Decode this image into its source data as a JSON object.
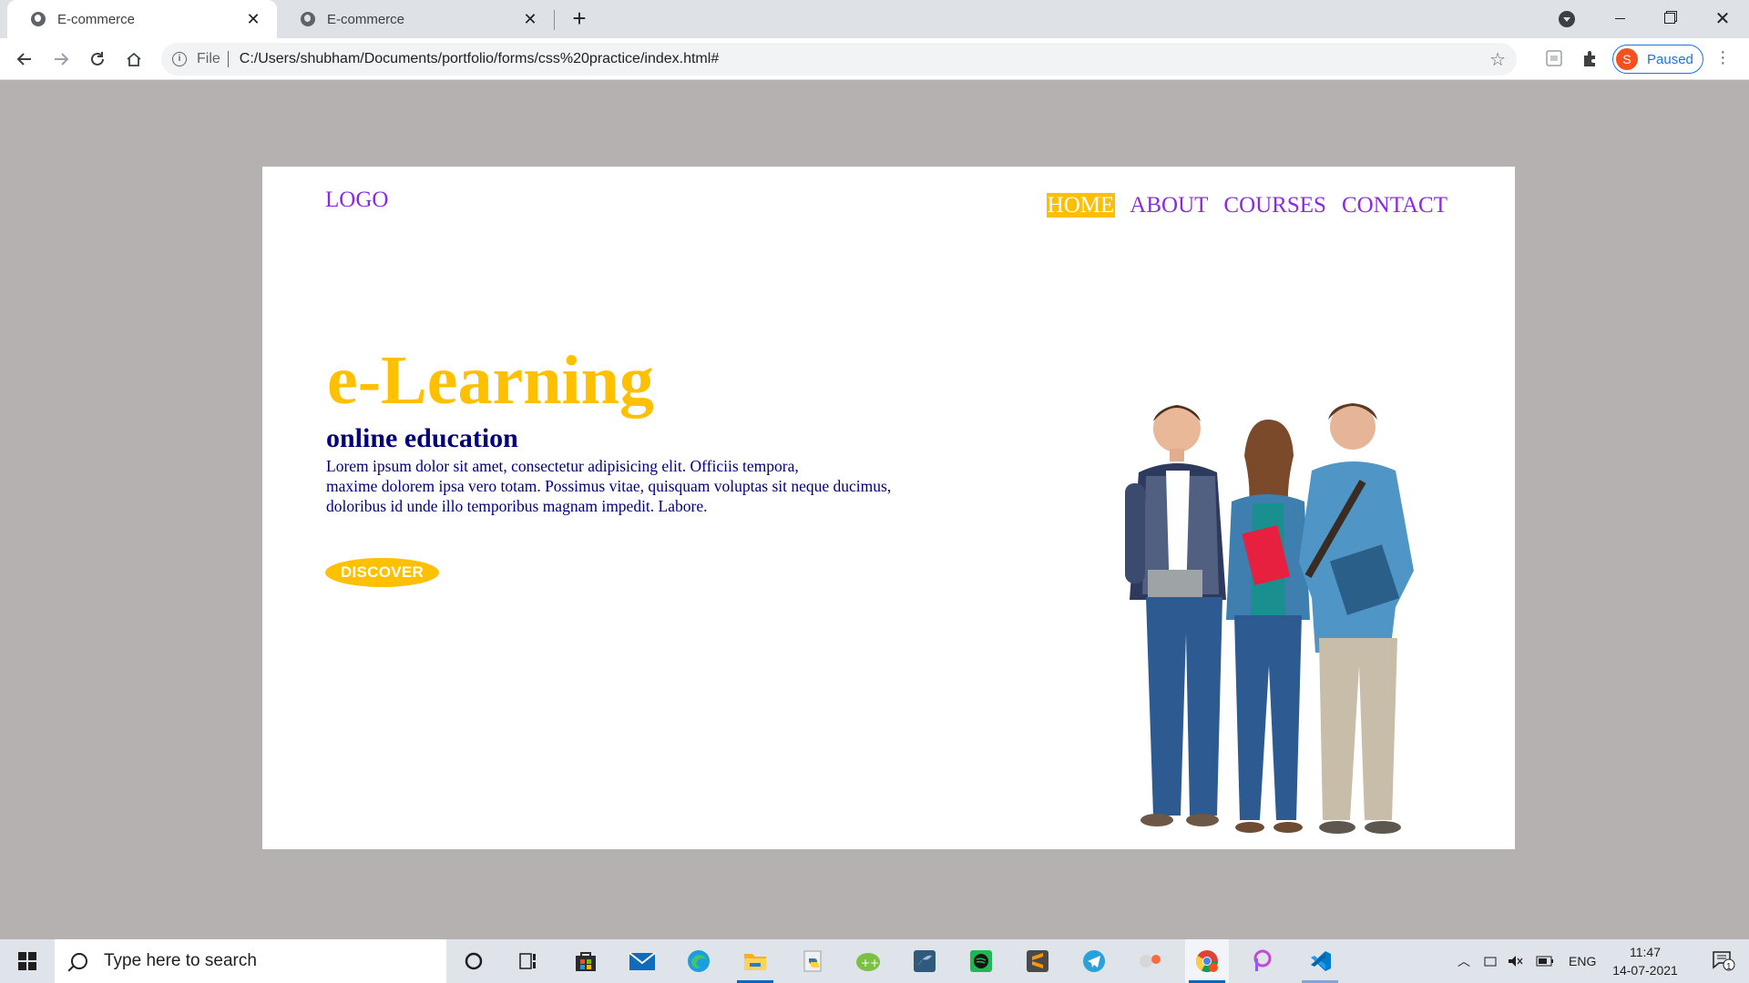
{
  "browser": {
    "tabs": [
      {
        "title": "E-commerce",
        "active": true
      },
      {
        "title": "E-commerce",
        "active": false
      }
    ],
    "tab_close_glyph": "✕",
    "new_tab_glyph": "+",
    "url_scheme_label": "File",
    "url": "C:/Users/shubham/Documents/portfolio/forms/css%20practice/index.html#",
    "profile": {
      "initial": "S",
      "status": "Paused"
    }
  },
  "page": {
    "logo": "LOGO",
    "nav": [
      {
        "label": "HOME",
        "active": true
      },
      {
        "label": "ABOUT",
        "active": false
      },
      {
        "label": "COURSES",
        "active": false
      },
      {
        "label": "CONTACT",
        "active": false
      }
    ],
    "hero": {
      "title": "e-Learning",
      "subtitle": "online education",
      "body_lines": [
        "Lorem ipsum dolor sit amet, consectetur adipisicing elit. Officiis tempora,",
        "maxime dolorem ipsa vero totam. Possimus vitae, quisquam voluptas sit neque ducimus,",
        "doloribus id unde illo temporibus magnam impedit. Labore."
      ],
      "cta_label": "DISCOVER"
    },
    "colors": {
      "accent": "#ffc000",
      "nav_text": "#8a2be2",
      "body_text": "#00007a",
      "page_bg": "#b5b1b0"
    }
  },
  "taskbar": {
    "search_placeholder": "Type here to search",
    "apps": [
      "cortana-icon",
      "task-view-icon",
      "store-icon",
      "mail-icon",
      "edge-icon",
      "file-explorer-icon",
      "python-idle-icon",
      "notepad-plus-icon",
      "mysql-workbench-icon",
      "spotify-icon",
      "sublime-text-icon",
      "telegram-icon",
      "recorder-icon",
      "chrome-icon",
      "picsart-icon",
      "vscode-icon"
    ],
    "language": "ENG",
    "time": "11:47",
    "date": "14-07-2021",
    "notification_count": "1"
  }
}
